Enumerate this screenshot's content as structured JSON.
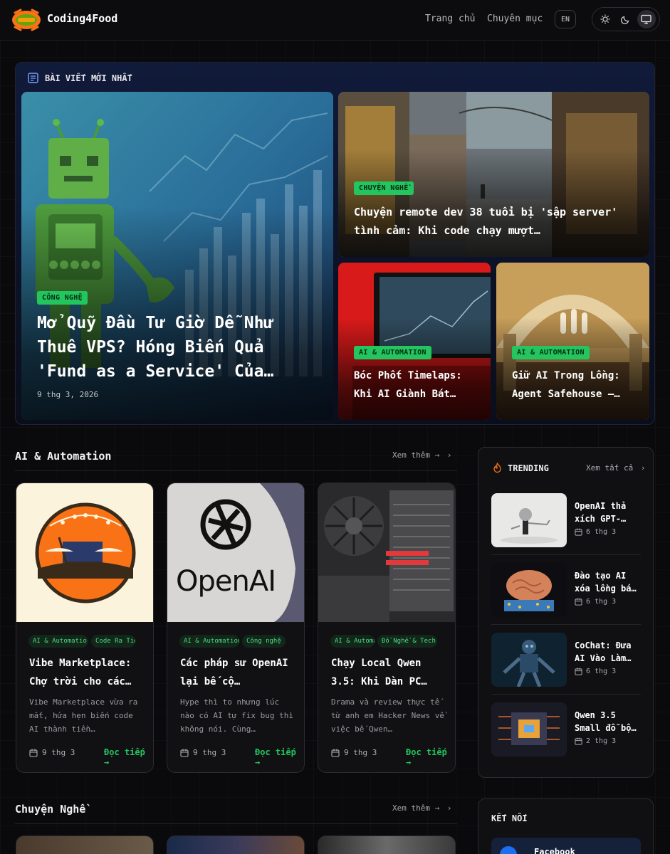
{
  "header": {
    "brand": "Coding4Food",
    "nav": [
      "Trang chủ",
      "Chuyên mục"
    ],
    "lang": "EN"
  },
  "latest": {
    "title": "BÀI VIẾT MỚI NHẤT",
    "featured": {
      "tag": "CÔNG NGHỆ",
      "title": "Mở Quỹ Đầu Tư Giờ Dễ Như Thuê VPS? Hóng Biến Quả 'Fund as a Service' Của…",
      "date": "9 thg 3, 2026"
    },
    "side": {
      "tag": "CHUYỆN NGHỀ",
      "title": "Chuyện remote dev 38 tuổi bị 'sập server' tình cảm: Khi code chạy mượt…"
    },
    "small1": {
      "tag": "AI & AUTOMATION",
      "title": "Bóc Phốt Timelaps: Khi AI Giành Bát…"
    },
    "small2": {
      "tag": "AI & AUTOMATION",
      "title": "Giữ AI Trong Lồng: Agent Safehouse –…"
    }
  },
  "ai_section": {
    "title": "AI & Automation",
    "see_more": "Xem thêm →",
    "posts": [
      {
        "chips": [
          "AI & Automatio",
          "Code Ra Tiền"
        ],
        "title": "Vibe Marketplace: Chợ trời cho các…",
        "desc": "Vibe Marketplace vừa ra mắt, hứa hẹn biến code AI thành tiền…",
        "date": "9 thg 3",
        "read": "Đọc tiếp →"
      },
      {
        "chips": [
          "AI & Automation",
          "Công nghệ"
        ],
        "title": "Các pháp sư OpenAI lại bế cộ…",
        "desc": "Hype thì to nhưng lúc nào có AI tự fix bug thì không nói. Cùng…",
        "date": "9 thg 3",
        "read": "Đọc tiếp →",
        "image_text": "OpenAI"
      },
      {
        "chips": [
          "AI & Automa",
          "Đồ Nghề & Tech"
        ],
        "title": "Chạy Local Qwen 3.5: Khi Dàn PC…",
        "desc": "Drama và review thực tế từ anh em Hacker News về việc bế Qwen…",
        "date": "9 thg 3",
        "read": "Đọc tiếp →"
      }
    ]
  },
  "trending": {
    "title": "TRENDING",
    "see_all": "Xem tất cả",
    "items": [
      {
        "title": "OpenAI thả xích GPT-…",
        "date": "6 thg 3"
      },
      {
        "title": "Đào tạo AI xóa lồng bá…",
        "date": "6 thg 3"
      },
      {
        "title": "CoChat: Đưa AI Vào Làm…",
        "date": "6 thg 3"
      },
      {
        "title": "Qwen 3.5 Small đỗ bộ…",
        "date": "2 thg 3"
      }
    ]
  },
  "career_section": {
    "title": "Chuyện Nghề",
    "see_more": "Xem thêm →"
  },
  "connect": {
    "title": "KẾT NỐI",
    "facebook": "Facebook"
  }
}
